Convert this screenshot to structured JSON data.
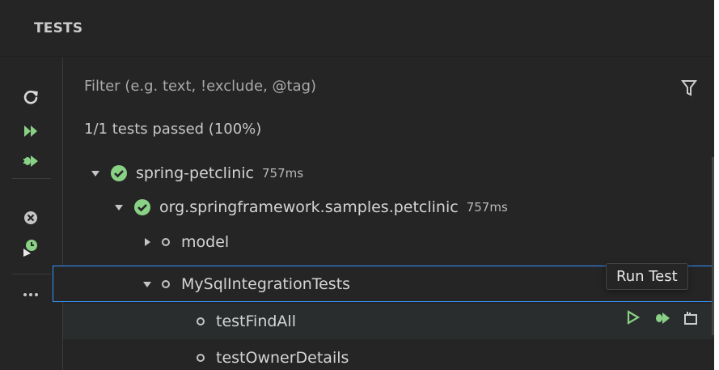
{
  "panel": {
    "title": "TESTS"
  },
  "filter": {
    "placeholder": "Filter (e.g. text, !exclude, @tag)"
  },
  "summary": "1/1 tests passed (100%)",
  "colors": {
    "green": "#89d185",
    "accent": "#3794ff",
    "background": "#252526"
  },
  "toolbar": {
    "buttons": [
      {
        "name": "refresh-icon"
      },
      {
        "name": "run-all-icon"
      },
      {
        "name": "debug-all-icon"
      },
      {
        "name": "clear-results-icon"
      },
      {
        "name": "coverage-icon"
      },
      {
        "name": "more-icon"
      }
    ]
  },
  "tree": {
    "root": {
      "label": "spring-petclinic",
      "duration": "757ms",
      "status": "passed"
    },
    "package": {
      "label": "org.springframework.samples.petclinic",
      "duration": "757ms",
      "status": "passed"
    },
    "model": {
      "label": "model",
      "status": "not-run"
    },
    "mysql": {
      "label": "MySqlIntegrationTests",
      "status": "not-run"
    },
    "findAll": {
      "label": "testFindAll",
      "status": "not-run"
    },
    "owner": {
      "label": "testOwnerDetails",
      "status": "not-run"
    }
  },
  "tooltip": "Run Test",
  "row_actions": [
    "run-icon",
    "debug-icon",
    "go-to-file-icon"
  ]
}
